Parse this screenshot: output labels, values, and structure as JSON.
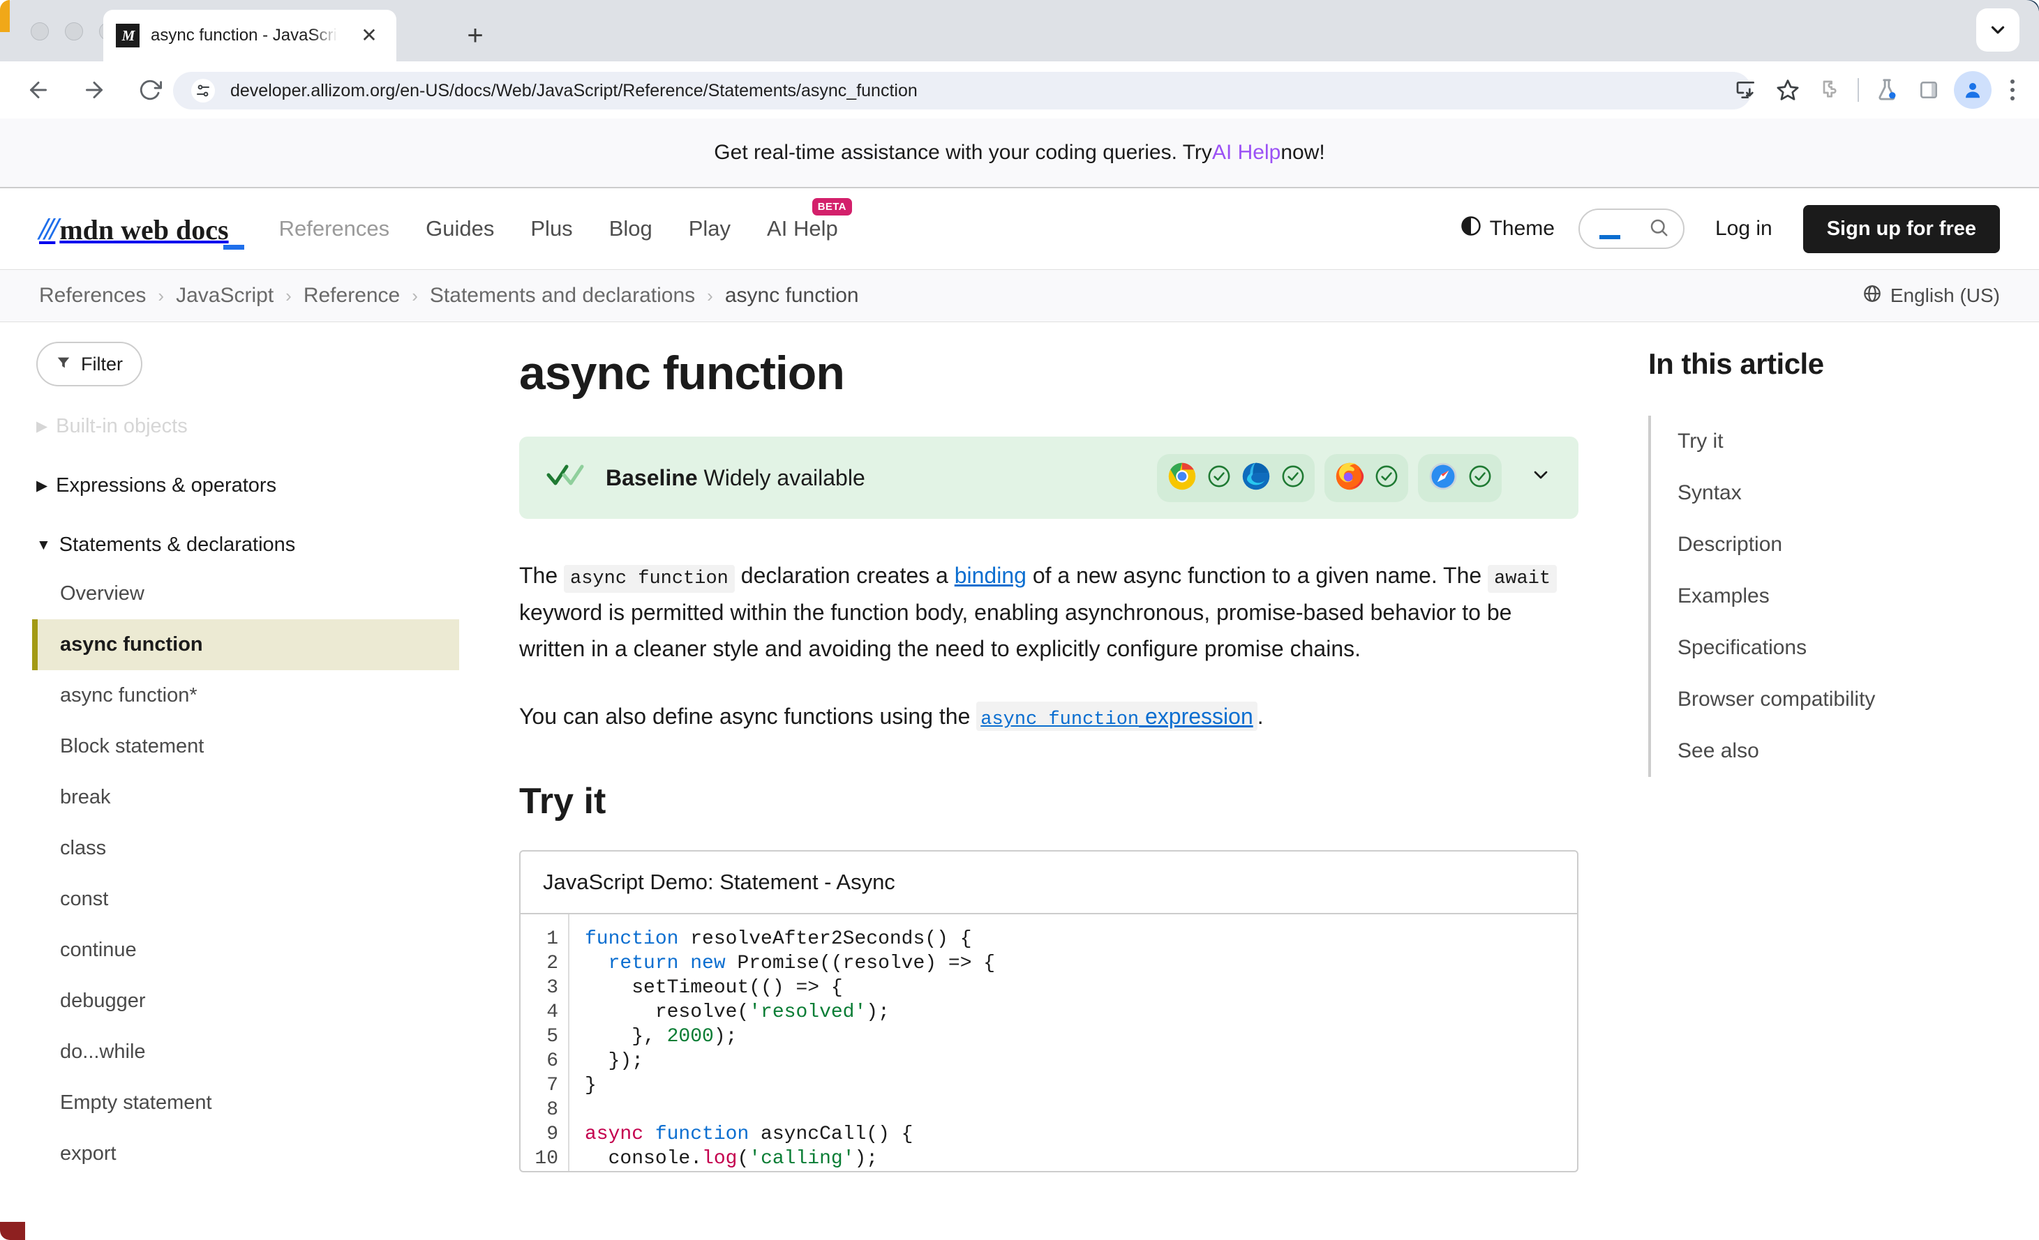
{
  "browser": {
    "tab": {
      "title": "async function - JavaScript |",
      "favicon_label": "M",
      "close_icon": "close-icon"
    },
    "newtab_label": "+",
    "url": "developer.allizom.org/en-US/docs/Web/JavaScript/Reference/Statements/async_function",
    "toolbar_icons": [
      "back-icon",
      "forward-icon",
      "reload-icon",
      "install-icon",
      "bookmark-star-icon",
      "extensions-icon",
      "labs-flask-icon",
      "side-panel-icon",
      "profile-avatar-icon",
      "more-menu-icon"
    ]
  },
  "promo": {
    "prefix": "Get real-time assistance with your coding queries. Try ",
    "link": "AI Help",
    "suffix": " now!"
  },
  "header": {
    "logo_mark": "///",
    "logo_text": "mdn web docs",
    "nav": [
      {
        "label": "References",
        "dim": true
      },
      {
        "label": "Guides",
        "dim": false
      },
      {
        "label": "Plus",
        "dim": false
      },
      {
        "label": "Blog",
        "dim": false
      },
      {
        "label": "Play",
        "dim": false
      },
      {
        "label": "AI Help",
        "dim": false,
        "badge": "BETA"
      }
    ],
    "theme_label": "Theme",
    "search_placeholder": "",
    "login_label": "Log in",
    "signup_label": "Sign up for free"
  },
  "breadcrumbs": {
    "items": [
      "References",
      "JavaScript",
      "Reference",
      "Statements and declarations",
      "async function"
    ],
    "separator": "›",
    "language": "English (US)"
  },
  "sidebar": {
    "filter_label": "Filter",
    "groups": [
      {
        "label": "Built-in objects",
        "marker": "▶",
        "faded": true
      },
      {
        "label": "Expressions & operators",
        "marker": "▶",
        "faded": false
      },
      {
        "label": "Statements & declarations",
        "marker": "▼",
        "faded": false
      }
    ],
    "items": [
      {
        "label": "Overview",
        "active": false
      },
      {
        "label": "async function",
        "active": true
      },
      {
        "label": "async function*",
        "active": false
      },
      {
        "label": "Block statement",
        "active": false
      },
      {
        "label": "break",
        "active": false
      },
      {
        "label": "class",
        "active": false
      },
      {
        "label": "const",
        "active": false
      },
      {
        "label": "continue",
        "active": false
      },
      {
        "label": "debugger",
        "active": false
      },
      {
        "label": "do...while",
        "active": false
      },
      {
        "label": "Empty statement",
        "active": false
      },
      {
        "label": "export",
        "active": false
      }
    ]
  },
  "article": {
    "title": "async function",
    "baseline": {
      "brand": "Baseline",
      "status": "Widely available",
      "browsers": [
        "chrome-icon",
        "edge-icon",
        "firefox-icon",
        "safari-icon"
      ],
      "expand_icon": "chevron-down-icon"
    },
    "p1": {
      "t1": "The ",
      "c1": "async function",
      "t2": " declaration creates a ",
      "link": "binding",
      "t3": " of a new async function to a given name. The ",
      "c2": "await",
      "t4": " keyword is permitted within the function body, enabling asynchronous, promise-based behavior to be written in a cleaner style and avoiding the need to explicitly configure promise chains."
    },
    "p2": {
      "t1": "You can also define async functions using the ",
      "code_link": "async function",
      "link": " expression",
      "t2": "."
    },
    "tryit_heading": "Try it",
    "demo": {
      "title": "JavaScript Demo: Statement - Async",
      "line_numbers": [
        "1",
        "2",
        "3",
        "4",
        "5",
        "6",
        "7",
        "8",
        "9",
        "10"
      ],
      "code_lines": [
        "function resolveAfter2Seconds() {",
        "  return new Promise((resolve) => {",
        "    setTimeout(() => {",
        "      resolve('resolved');",
        "    }, 2000);",
        "  });",
        "}",
        "",
        "async function asyncCall() {",
        "  console.log('calling');"
      ]
    }
  },
  "toc": {
    "title": "In this article",
    "items": [
      "Try it",
      "Syntax",
      "Description",
      "Examples",
      "Specifications",
      "Browser compatibility",
      "See also"
    ]
  },
  "colors": {
    "accent_blue": "#0b6ed0",
    "baseline_green": "#e2f3e5",
    "active_sidebar": "#ecead3",
    "active_sidebar_border": "#a39a14",
    "beta_badge": "#d3206b",
    "ai_help_purple": "#9b51f5"
  }
}
